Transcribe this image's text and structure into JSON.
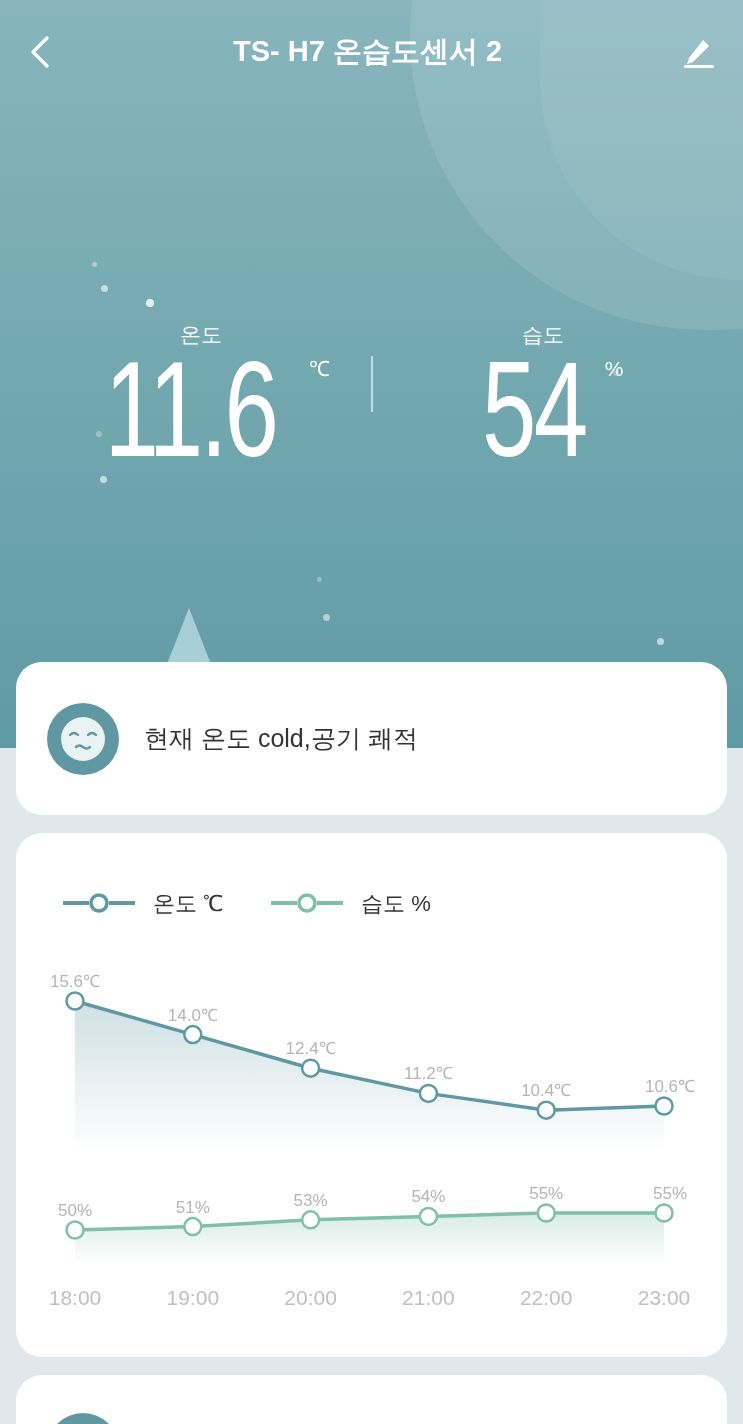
{
  "header": {
    "title": "TS- H7 온습도센서 2"
  },
  "readings": [
    {
      "label": "온도",
      "value": "11.6",
      "unit": "℃"
    },
    {
      "label": "습도",
      "value": "54",
      "unit": "%"
    }
  ],
  "status": {
    "text": "현재 온도 cold,공기 쾌적"
  },
  "chart": {
    "legend": [
      {
        "name": "온도 ℃"
      },
      {
        "name": "습도 %"
      }
    ],
    "temperature_chart": {
      "chart_data": {
        "type": "area",
        "data_labels": true,
        "series": [
          {
            "color": "#5f98a3",
            "marker": "circle",
            "values": [
              15.6,
              14.0,
              12.4,
              11.2,
              10.4,
              10.6
            ],
            "value_labels": [
              "15.6℃",
              "14.0℃",
              "12.4℃",
              "11.2℃",
              "10.4℃",
              "10.6℃"
            ]
          }
        ]
      }
    },
    "humidity_chart": {
      "chart_data": {
        "type": "area",
        "categories": [
          "18:00",
          "19:00",
          "20:00",
          "21:00",
          "22:00",
          "23:00"
        ],
        "data_labels": true,
        "series": [
          {
            "color": "#7fbfab",
            "marker": "circle",
            "values": [
              50,
              51,
              53,
              54,
              55,
              55
            ],
            "value_labels": [
              "50%",
              "51%",
              "53%",
              "54%",
              "55%",
              "55%"
            ]
          }
        ]
      }
    }
  }
}
